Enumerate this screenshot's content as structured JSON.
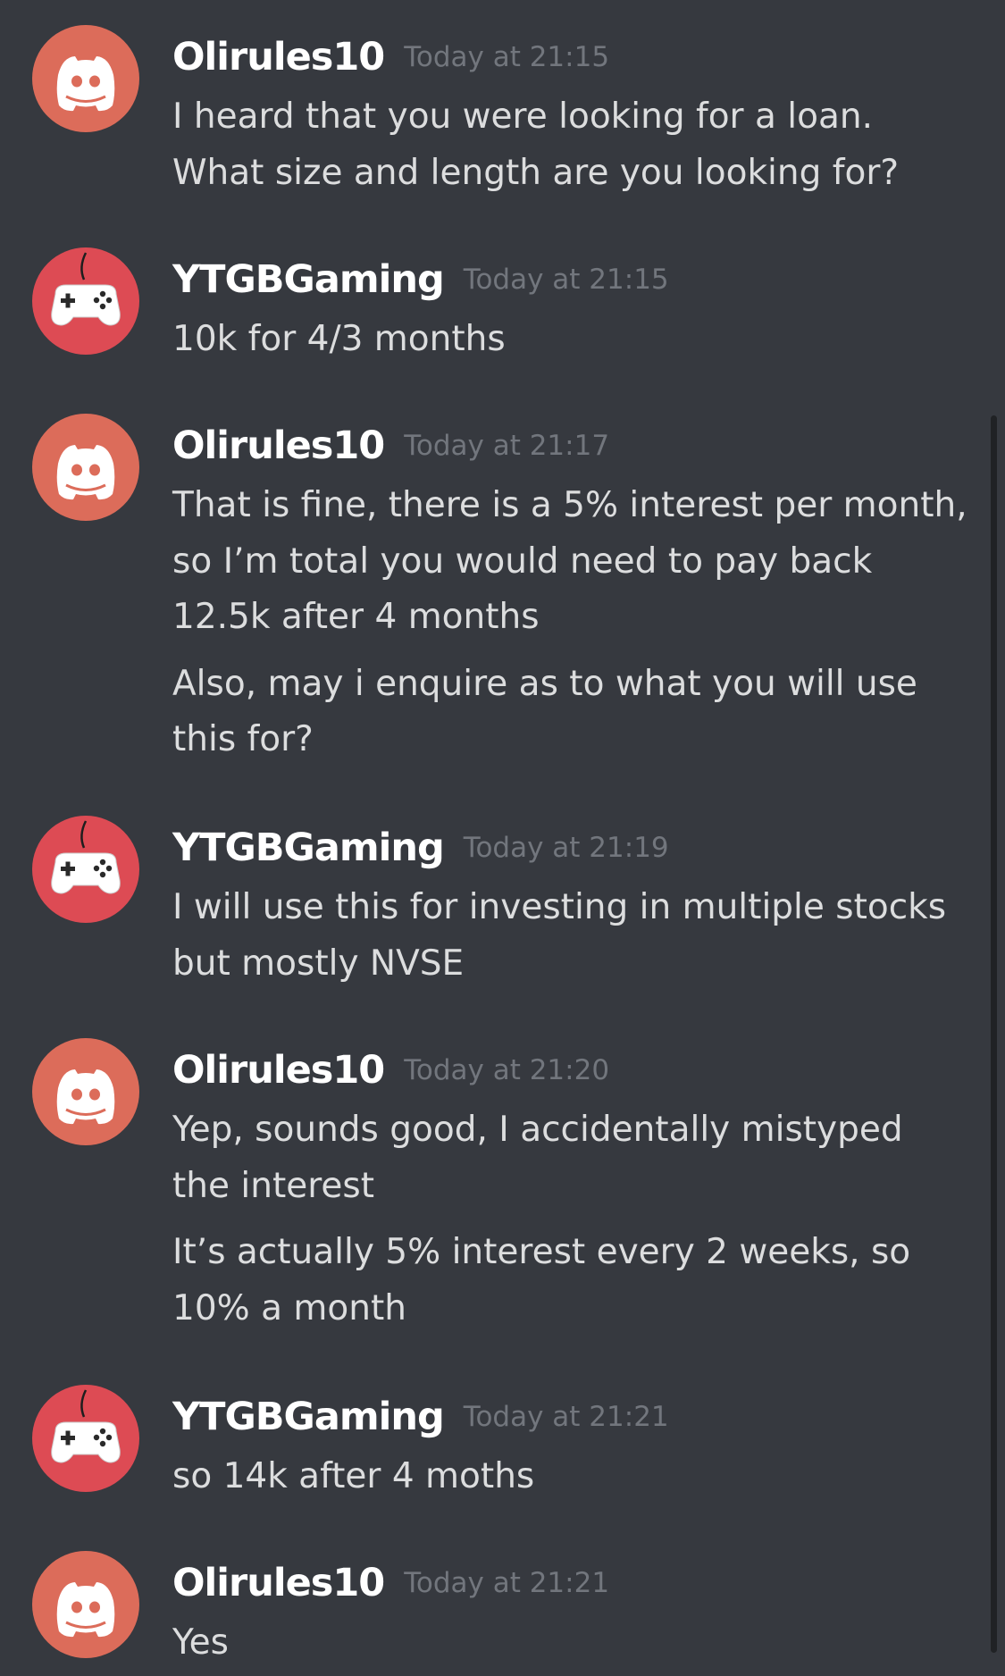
{
  "colors": {
    "background": "#36393f",
    "username": "#ffffff",
    "timestamp": "#72767d",
    "message_text": "#dcddde",
    "avatar_olirules": "#dc6c5a",
    "avatar_ytgb": "#dd4b54"
  },
  "messages": [
    {
      "username": "Olirules10",
      "avatar_icon": "discord-logo-icon",
      "timestamp": "Today at 21:15",
      "lines": [
        "I heard that you were looking for a loan.",
        "What size and length are you looking for?"
      ]
    },
    {
      "username": "YTGBGaming",
      "avatar_icon": "gamepad-icon",
      "timestamp": "Today at 21:15",
      "lines": [
        "10k for 4/3 months"
      ]
    },
    {
      "username": "Olirules10",
      "avatar_icon": "discord-logo-icon",
      "timestamp": "Today at 21:17",
      "lines": [
        "That is fine, there is a 5% interest per month,",
        "so I’m total you would need to pay back",
        "12.5k after 4 months"
      ],
      "followup_lines": [
        "Also, may i enquire as to what you will use",
        "this for?"
      ]
    },
    {
      "username": "YTGBGaming",
      "avatar_icon": "gamepad-icon",
      "timestamp": "Today at 21:19",
      "lines": [
        "I will use this for investing in multiple stocks",
        "but mostly NVSE"
      ]
    },
    {
      "username": "Olirules10",
      "avatar_icon": "discord-logo-icon",
      "timestamp": "Today at 21:20",
      "lines": [
        "Yep, sounds good, I accidentally mistyped",
        "the interest"
      ],
      "followup_lines": [
        "It’s actually 5% interest every 2 weeks, so",
        "10% a month"
      ]
    },
    {
      "username": "YTGBGaming",
      "avatar_icon": "gamepad-icon",
      "timestamp": "Today at 21:21",
      "lines": [
        "so 14k after 4 moths"
      ]
    },
    {
      "username": "Olirules10",
      "avatar_icon": "discord-logo-icon",
      "timestamp": "Today at 21:21",
      "lines": [
        "Yes"
      ]
    }
  ]
}
